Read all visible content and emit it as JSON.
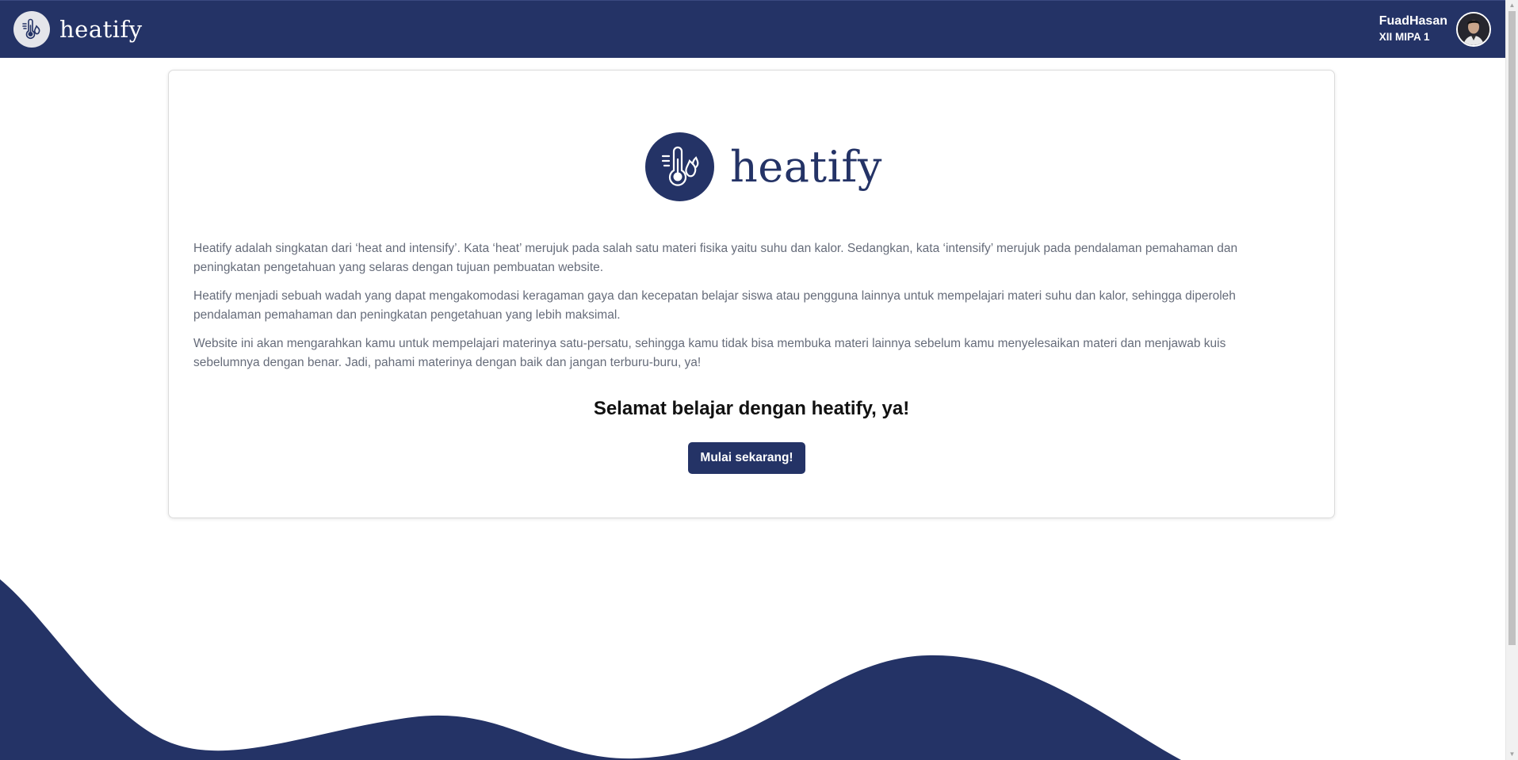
{
  "navbar": {
    "brand_name": "heatify",
    "user": {
      "name": "FuadHasan",
      "class": "XII MIPA 1"
    }
  },
  "card": {
    "logo_text": "heatify",
    "paragraphs": [
      "Heatify adalah singkatan dari ‘heat and intensify’. Kata ‘heat’ merujuk pada salah satu materi fisika yaitu suhu dan kalor. Sedangkan, kata ‘intensify’ merujuk pada pendalaman pemahaman dan peningkatan pengetahuan yang selaras dengan tujuan pembuatan website.",
      "Heatify menjadi sebuah wadah yang dapat mengakomodasi keragaman gaya dan kecepatan belajar siswa atau pengguna lainnya untuk mempelajari materi suhu dan kalor, sehingga diperoleh pendalaman pemahaman dan peningkatan pengetahuan yang lebih maksimal.",
      "Website ini akan mengarahkan kamu untuk mempelajari materinya satu-persatu, sehingga kamu tidak bisa membuka materi lainnya sebelum kamu menyelesaikan materi dan menjawab kuis sebelumnya dengan benar. Jadi, pahami materinya dengan baik dan jangan terburu-buru, ya!"
    ],
    "cta_title": "Selamat belajar dengan heatify, ya!",
    "cta_button": "Mulai sekarang!"
  },
  "colors": {
    "primary": "#243366",
    "text_muted": "#666c7a",
    "background": "#ffffff"
  },
  "icons": {
    "brand": "thermometer-flame-icon",
    "avatar": "user-avatar"
  }
}
